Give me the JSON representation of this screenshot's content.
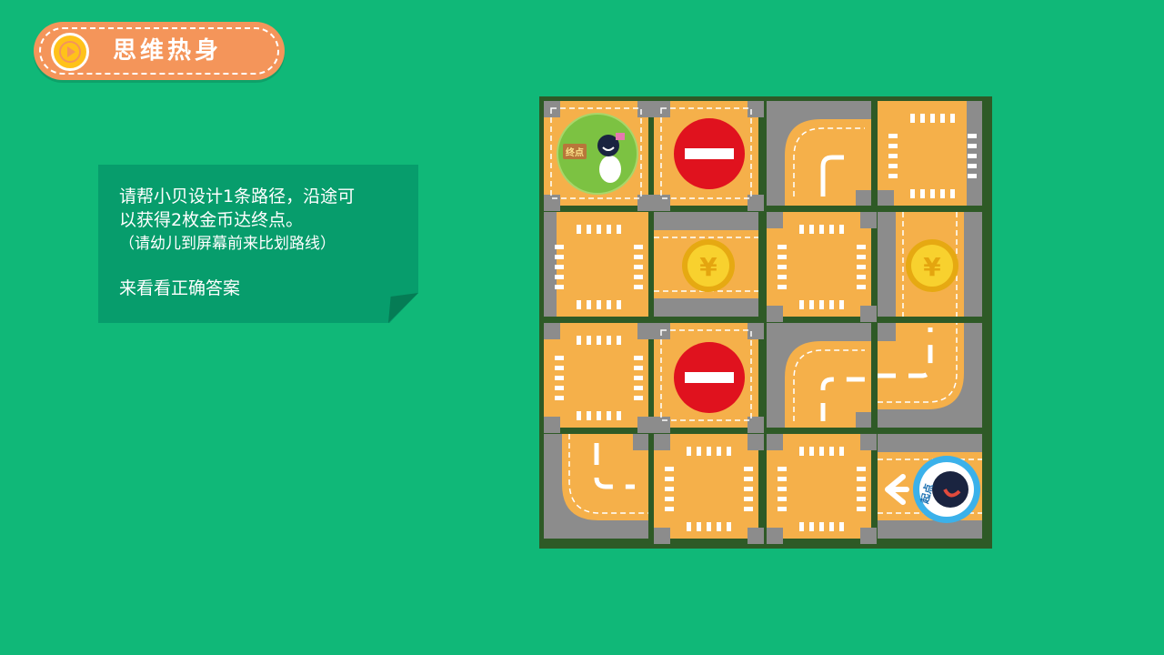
{
  "header": {
    "title": "思维热身",
    "play_icon": "play-icon"
  },
  "instruction": {
    "line1": "请帮小贝设计1条路径，沿途可",
    "line2": "以获得2枚金币达终点。",
    "line3": "（请幼儿到屏幕前来比划路线）",
    "answer_link": "来看看正确答案"
  },
  "board": {
    "rows": 4,
    "cols": 4,
    "tiles": [
      [
        "finish",
        "no-entry",
        "curve",
        "crossroad"
      ],
      [
        "crossroad",
        "coin",
        "crossroad",
        "coin"
      ],
      [
        "crossroad",
        "no-entry",
        "curve",
        "curve"
      ],
      [
        "curve",
        "crossroad",
        "crossroad",
        "start"
      ]
    ],
    "finish_label": "终点",
    "start_label": "起点",
    "coin_symbol": "¥",
    "colors": {
      "background": "#10b878",
      "road": "#f5b04a",
      "asphalt": "#8c8c8c",
      "no_entry": "#e0121e",
      "coin": "#f3c21f"
    }
  }
}
